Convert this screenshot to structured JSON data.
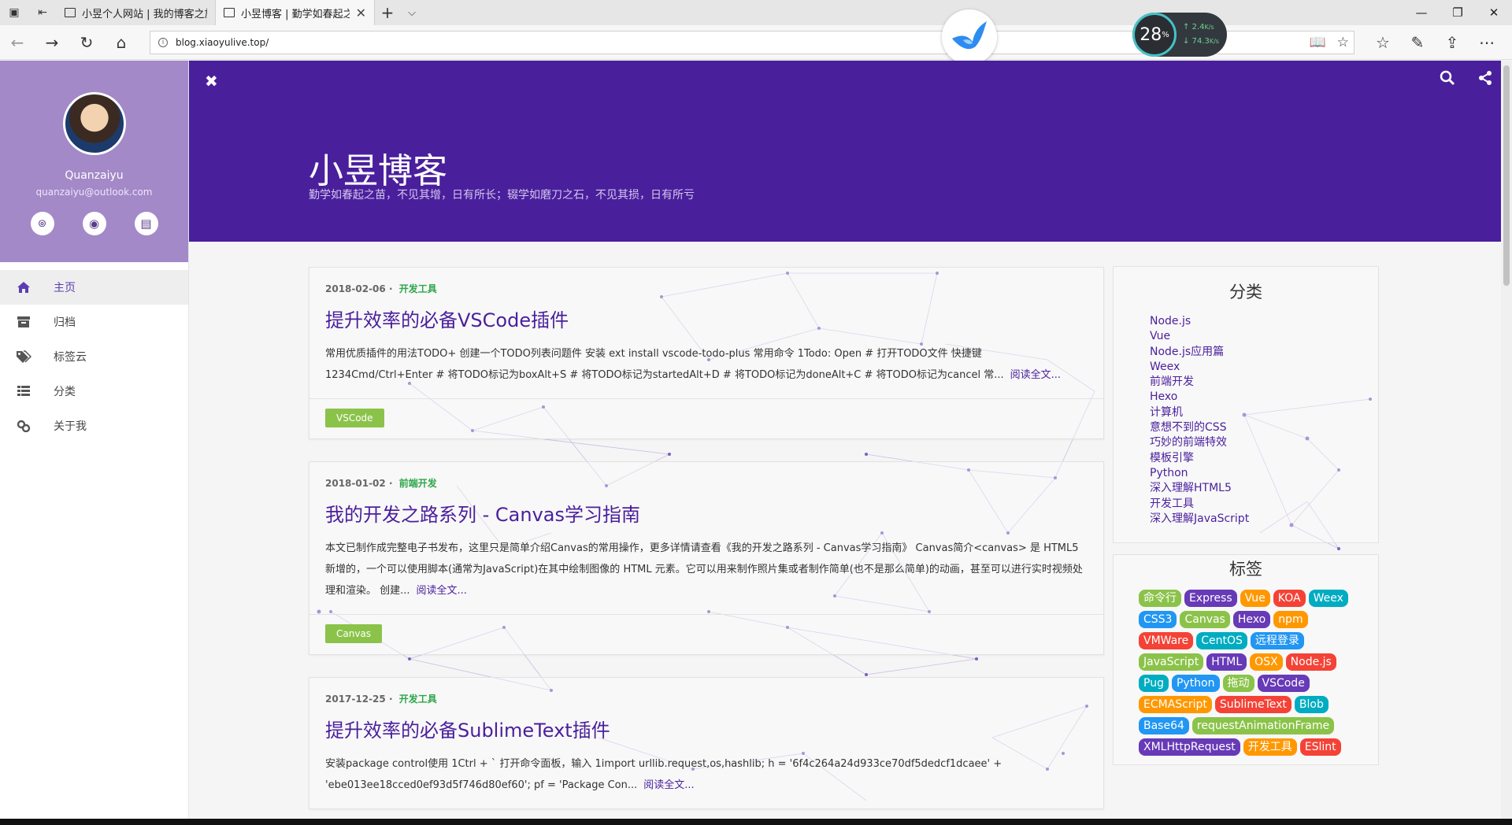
{
  "browser": {
    "tabs": [
      {
        "title": "小昱个人网站 | 我的博客之旅",
        "active": false
      },
      {
        "title": "小昱博客 | 勤学如春起之苗",
        "active": true
      }
    ],
    "url": "blog.xiaoyulive.top/",
    "speed": {
      "percent": "28",
      "percent_unit": "%",
      "up": "2.4",
      "up_unit": "K/s",
      "down": "74.3",
      "down_unit": "K/s"
    }
  },
  "sidebar": {
    "author": "Quanzaiyu",
    "email": "quanzaiyu@outlook.com",
    "menu": [
      {
        "label": "主页",
        "icon": "home-icon",
        "active": true
      },
      {
        "label": "归档",
        "icon": "archive-icon",
        "active": false
      },
      {
        "label": "标签云",
        "icon": "tags-icon",
        "active": false
      },
      {
        "label": "分类",
        "icon": "list-icon",
        "active": false
      },
      {
        "label": "关于我",
        "icon": "link-icon",
        "active": false
      }
    ]
  },
  "header": {
    "title": "小昱博客",
    "subtitle": "勤学如春起之苗，不见其增，日有所长；辍学如磨刀之石，不见其损，日有所亏"
  },
  "posts": [
    {
      "date": "2018-02-06",
      "category": "开发工具",
      "title": "提升效率的必备VSCode插件",
      "excerpt": "常用优质插件的用法TODO+ 创建一个TODO列表问题件 安装 ext install vscode-todo-plus 常用命令 1Todo: Open # 打开TODO文件 快捷键 1234Cmd/Ctrl+Enter # 将TODO标记为boxAlt+S # 将TODO标记为startedAlt+D # 将TODO标记为doneAlt+C # 将TODO标记为cancel 常...",
      "read_more": "阅读全文...",
      "tag": "VSCode"
    },
    {
      "date": "2018-01-02",
      "category": "前端开发",
      "title": "我的开发之路系列 - Canvas学习指南",
      "excerpt": "本文已制作成完整电子书发布，这里只是简单介绍Canvas的常用操作，更多详情请查看《我的开发之路系列 - Canvas学习指南》 Canvas简介<canvas> 是 HTML5 新增的，一个可以使用脚本(通常为JavaScript)在其中绘制图像的 HTML 元素。它可以用来制作照片集或者制作简单(也不是那么简单)的动画，甚至可以进行实时视频处理和渲染。 创建...",
      "read_more": "阅读全文...",
      "tag": "Canvas"
    },
    {
      "date": "2017-12-25",
      "category": "开发工具",
      "title": "提升效率的必备SublimeText插件",
      "excerpt": "安装package control使用 1Ctrl + ` 打开命令面板，输入 1import urllib.request,os,hashlib; h = '6f4c264a24d933ce70df5dedcf1dcaee' + 'ebe013ee18cced0ef93d5f746d80ef60'; pf = 'Package Con...",
      "read_more": "阅读全文...",
      "tag": ""
    }
  ],
  "categories_widget": {
    "title": "分类",
    "items": [
      "Node.js",
      "Vue",
      "Node.js应用篇",
      "Weex",
      "前端开发",
      "Hexo",
      "计算机",
      "意想不到的CSS",
      "巧妙的前端特效",
      "模板引擎",
      "Python",
      "深入理解HTML5",
      "开发工具",
      "深入理解JavaScript"
    ]
  },
  "tags_widget": {
    "title": "标签",
    "items": [
      {
        "label": "命令行",
        "color": "#8bc34a"
      },
      {
        "label": "Express",
        "color": "#673ab7"
      },
      {
        "label": "Vue",
        "color": "#ff9800"
      },
      {
        "label": "KOA",
        "color": "#f44336"
      },
      {
        "label": "Weex",
        "color": "#00acc1"
      },
      {
        "label": "CSS3",
        "color": "#2196f3"
      },
      {
        "label": "Canvas",
        "color": "#8bc34a"
      },
      {
        "label": "Hexo",
        "color": "#673ab7"
      },
      {
        "label": "npm",
        "color": "#ff9800"
      },
      {
        "label": "VMWare",
        "color": "#f44336"
      },
      {
        "label": "CentOS",
        "color": "#00acc1"
      },
      {
        "label": "远程登录",
        "color": "#2196f3"
      },
      {
        "label": "JavaScript",
        "color": "#8bc34a"
      },
      {
        "label": "HTML",
        "color": "#673ab7"
      },
      {
        "label": "OSX",
        "color": "#ff9800"
      },
      {
        "label": "Node.js",
        "color": "#f44336"
      },
      {
        "label": "Pug",
        "color": "#00acc1"
      },
      {
        "label": "Python",
        "color": "#2196f3"
      },
      {
        "label": "拖动",
        "color": "#8bc34a"
      },
      {
        "label": "VSCode",
        "color": "#673ab7"
      },
      {
        "label": "ECMAScript",
        "color": "#ff9800"
      },
      {
        "label": "SublimeText",
        "color": "#f44336"
      },
      {
        "label": "Blob",
        "color": "#00acc1"
      },
      {
        "label": "Base64",
        "color": "#2196f3"
      },
      {
        "label": "requestAnimationFrame",
        "color": "#8bc34a"
      },
      {
        "label": "XMLHttpRequest",
        "color": "#673ab7"
      },
      {
        "label": "开发工具",
        "color": "#ff9800"
      },
      {
        "label": "ESlint",
        "color": "#f44336"
      }
    ]
  }
}
